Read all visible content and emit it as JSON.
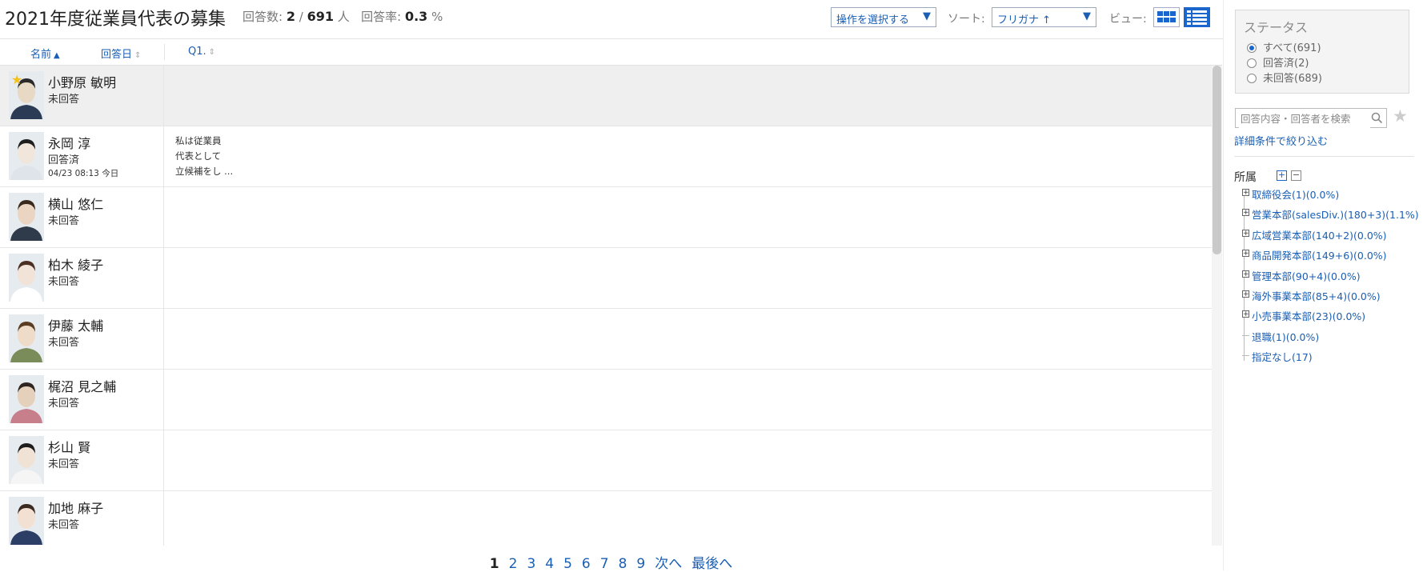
{
  "header": {
    "title": "2021年度従業員代表の募集",
    "responses_label": "回答数:",
    "responses_count": "2",
    "separator": "/",
    "total_count": "691",
    "person_unit": "人",
    "rate_label": "回答率:",
    "rate_value": "0.3",
    "rate_unit": "%",
    "action_select": "操作を選択する",
    "sort_label": "ソート:",
    "sort_select": "フリガナ ↑",
    "view_label": "ビュー:"
  },
  "columns": {
    "name": "名前",
    "answered_date": "回答日",
    "q1": "Q1."
  },
  "rows": [
    {
      "name": "小野原 敏明",
      "status": "未回答",
      "date": "",
      "answer": "",
      "selected": true,
      "starred": true
    },
    {
      "name": "永岡 淳",
      "status": "回答済",
      "date": "04/23 08:13 今日",
      "answer": "私は従業員\n代表として\n立候補をし ...",
      "selected": false,
      "starred": false
    },
    {
      "name": "横山 悠仁",
      "status": "未回答",
      "date": "",
      "answer": "",
      "selected": false,
      "starred": false
    },
    {
      "name": "柏木 綾子",
      "status": "未回答",
      "date": "",
      "answer": "",
      "selected": false,
      "starred": false
    },
    {
      "name": "伊藤 太輔",
      "status": "未回答",
      "date": "",
      "answer": "",
      "selected": false,
      "starred": false
    },
    {
      "name": "梶沼 見之輔",
      "status": "未回答",
      "date": "",
      "answer": "",
      "selected": false,
      "starred": false
    },
    {
      "name": "杉山 賢",
      "status": "未回答",
      "date": "",
      "answer": "",
      "selected": false,
      "starred": false
    },
    {
      "name": "加地 麻子",
      "status": "未回答",
      "date": "",
      "answer": "",
      "selected": false,
      "starred": false
    }
  ],
  "pagination": {
    "pages": [
      "1",
      "2",
      "3",
      "4",
      "5",
      "6",
      "7",
      "8",
      "9"
    ],
    "current": "1",
    "next": "次へ",
    "last": "最後へ"
  },
  "sidebar": {
    "status_title": "ステータス",
    "status_options": [
      {
        "label": "すべて(691)",
        "checked": true
      },
      {
        "label": "回答済(2)",
        "checked": false
      },
      {
        "label": "未回答(689)",
        "checked": false
      }
    ],
    "search_placeholder": "回答内容・回答者を検索",
    "advanced_filter": "詳細条件で絞り込む",
    "department_title": "所属",
    "departments": [
      {
        "label": "取締役会(1)(0.0%)",
        "expandable": true
      },
      {
        "label": "営業本部(salesDiv.)(180+3)(1.1%)",
        "expandable": true
      },
      {
        "label": "広域営業本部(140+2)(0.0%)",
        "expandable": true
      },
      {
        "label": "商品開発本部(149+6)(0.0%)",
        "expandable": true
      },
      {
        "label": "管理本部(90+4)(0.0%)",
        "expandable": true
      },
      {
        "label": "海外事業本部(85+4)(0.0%)",
        "expandable": true
      },
      {
        "label": "小売事業本部(23)(0.0%)",
        "expandable": true
      },
      {
        "label": "退職(1)(0.0%)",
        "expandable": false
      },
      {
        "label": "指定なし(17)",
        "expandable": false
      }
    ]
  },
  "colors": {
    "link": "#1a5fb4",
    "accent": "#1a66cc",
    "selected_row": "#efefef"
  }
}
